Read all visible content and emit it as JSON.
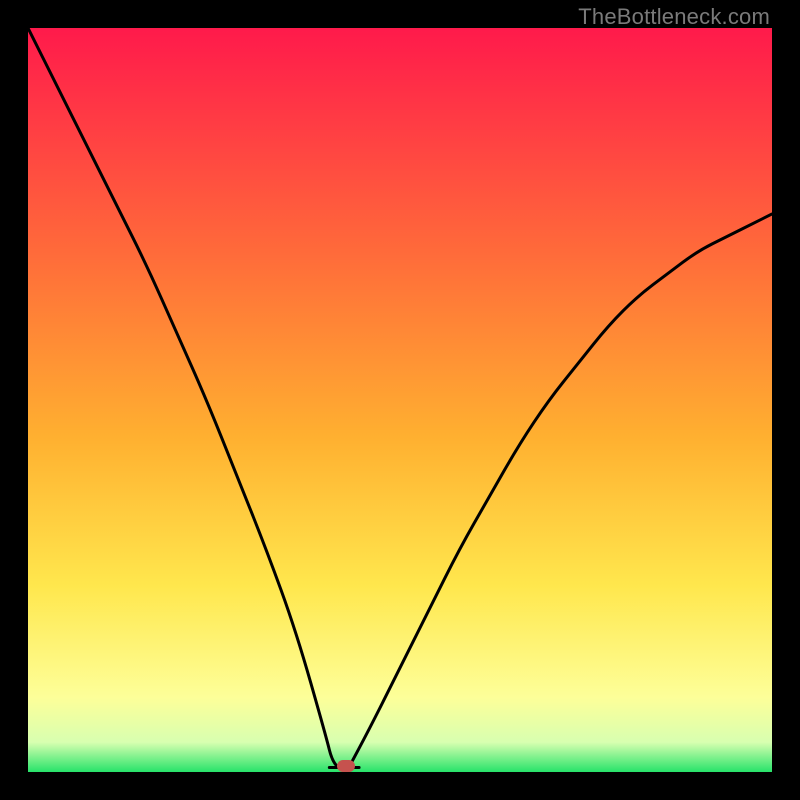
{
  "watermark": "TheBottleneck.com",
  "marker": {
    "color": "#c6524e",
    "x_pct": 42.8,
    "y_pct": 99.2
  },
  "chart_data": {
    "type": "line",
    "title": "",
    "xlabel": "",
    "ylabel": "",
    "xlim": [
      0,
      100
    ],
    "ylim": [
      0,
      100
    ],
    "grid": false,
    "legend": false,
    "background_gradient_stops": [
      {
        "pct": 0,
        "color": "#ff1a4b"
      },
      {
        "pct": 30,
        "color": "#ff6a3a"
      },
      {
        "pct": 55,
        "color": "#ffb030"
      },
      {
        "pct": 75,
        "color": "#ffe74d"
      },
      {
        "pct": 90,
        "color": "#fdff99"
      },
      {
        "pct": 96,
        "color": "#d8ffb0"
      },
      {
        "pct": 100,
        "color": "#27e36a"
      }
    ],
    "series": [
      {
        "name": "left-branch",
        "x": [
          0,
          4,
          8,
          12,
          16,
          20,
          24,
          28,
          32,
          36,
          40,
          41,
          42.8
        ],
        "y": [
          100,
          92,
          84,
          76,
          68,
          59,
          50,
          40,
          30,
          19,
          5,
          1,
          0
        ]
      },
      {
        "name": "notch-flat",
        "x": [
          40.5,
          44.5
        ],
        "y": [
          0.6,
          0.6
        ]
      },
      {
        "name": "right-branch",
        "x": [
          42.8,
          46,
          50,
          54,
          58,
          62,
          66,
          70,
          74,
          78,
          82,
          86,
          90,
          94,
          98,
          100
        ],
        "y": [
          0,
          6,
          14,
          22,
          30,
          37,
          44,
          50,
          55,
          60,
          64,
          67,
          70,
          72,
          74,
          75
        ]
      }
    ],
    "marker_point": {
      "x": 42.8,
      "y": 0.8
    }
  }
}
